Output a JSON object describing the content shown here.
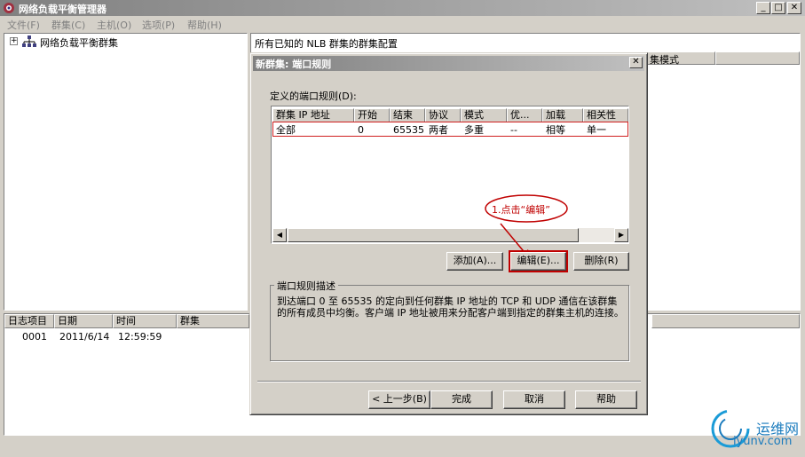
{
  "window": {
    "title": "网络负载平衡管理器"
  },
  "menubar": [
    "文件(F)",
    "群集(C)",
    "主机(O)",
    "选项(P)",
    "帮助(H)"
  ],
  "tree": {
    "root_label": "网络负载平衡群集"
  },
  "right_pane": {
    "header": "所有已知的 NLB 群集的群集配置",
    "col_mode": "集模式"
  },
  "log": {
    "columns": [
      "日志项目",
      "日期",
      "时间",
      "群集"
    ],
    "rows": [
      {
        "id": "0001",
        "date": "2011/6/14",
        "time": "12:59:59",
        "cluster": ""
      }
    ]
  },
  "dialog": {
    "title": "新群集:  端口规则",
    "rules_label": "定义的端口规则(D):",
    "columns": [
      "群集 IP 地址",
      "开始",
      "结束",
      "协议",
      "模式",
      "优...",
      "加载",
      "相关性"
    ],
    "rows": [
      {
        "ip": "全部",
        "start": "0",
        "end": "65535",
        "protocol": "两者",
        "mode": "多重",
        "priority": "--",
        "load": "相等",
        "affinity": "单一"
      }
    ],
    "buttons": {
      "add": "添加(A)...",
      "edit": "编辑(E)...",
      "delete": "删除(R)"
    },
    "desc_title": "端口规则描述",
    "desc_text": "到达端口 0 至 65535 的定向到任何群集 IP 地址的 TCP 和 UDP 通信在该群集的所有成员中均衡。客户端 IP 地址被用来分配客户端到指定的群集主机的连接。",
    "footer": {
      "back": "< 上一步(B)",
      "finish": "完成",
      "cancel": "取消",
      "help": "帮助"
    }
  },
  "annotation": {
    "text": "1.点击“编辑”",
    "color": "#c00000"
  },
  "watermark": {
    "line1": "运维网",
    "line2": "iyunv.com"
  },
  "colors": {
    "highlight": "#d02020",
    "title_gradient_start": "#808080",
    "title_gradient_end": "#c0c0c0"
  }
}
